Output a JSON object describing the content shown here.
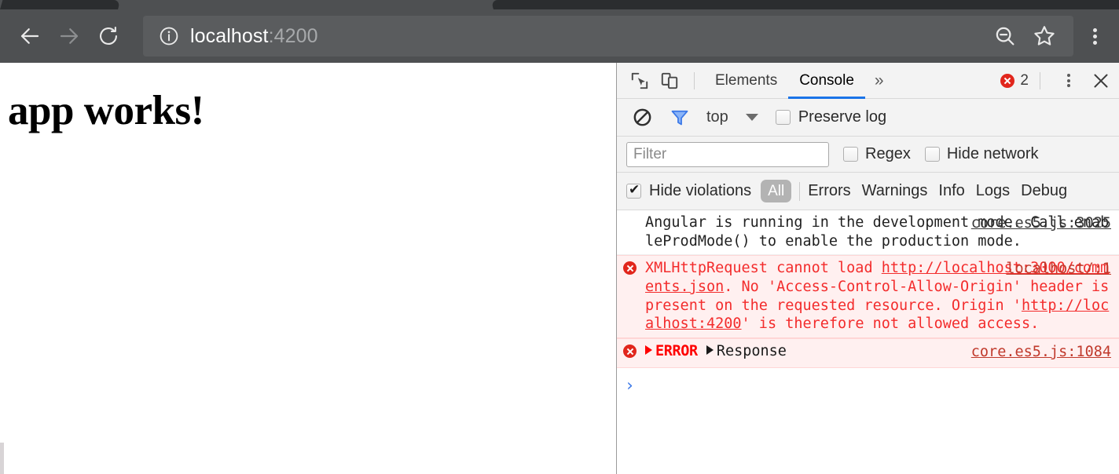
{
  "browser": {
    "back_icon": "arrow-left-icon",
    "forward_icon": "arrow-right-icon",
    "reload_icon": "reload-icon",
    "site_info_icon": "info-circle-icon",
    "url_host": "localhost",
    "url_port": ":4200",
    "zoom_out_icon": "magnifier-minus-icon",
    "bookmark_icon": "star-icon",
    "menu_icon": "kebab-menu-icon",
    "chrome_bg": "#4e5052",
    "omnibox_bg": "#5a5c5e"
  },
  "page": {
    "heading": "app works!"
  },
  "devtools": {
    "inspect_icon": "inspect-element-icon",
    "device_toolbar_icon": "device-toggle-icon",
    "tabs": [
      {
        "label": "Elements",
        "active": false
      },
      {
        "label": "Console",
        "active": true
      }
    ],
    "more_tabs_icon": "chevron-double-right-icon",
    "error_badge_icon": "error-circle-icon",
    "error_count": "2",
    "kebab_icon": "kebab-menu-icon",
    "close_icon": "close-x-icon",
    "accent": "#1a73e8"
  },
  "console_toolbar": {
    "clear_icon": "clear-console-icon",
    "filter_icon": "filter-funnel-icon",
    "context_label": "top",
    "context_caret_icon": "chevron-down-icon",
    "preserve_log_label": "Preserve log",
    "preserve_log_checked": false
  },
  "filter_bar": {
    "filter_placeholder": "Filter",
    "filter_value": "",
    "regex_label": "Regex",
    "regex_checked": false,
    "hide_network_label": "Hide network",
    "hide_network_checked": false
  },
  "levels_bar": {
    "hide_violations_label": "Hide violations",
    "hide_violations_checked": true,
    "selected_level": "All",
    "levels": [
      "Errors",
      "Warnings",
      "Info",
      "Logs",
      "Debug"
    ]
  },
  "console_messages": [
    {
      "type": "info",
      "icon": "",
      "text": "Angular is running in the development mode. Call enableProdMode() to enable the production mode.",
      "source": "core.es5.js:3025"
    },
    {
      "type": "error",
      "icon": "error-circle-icon",
      "text_part1": "XMLHttpRequest cannot load ",
      "link": "http://localhost:3000/comments.json",
      "text_part2": ". No 'Access-Control-Allow-Origin' header is present on the requested resource. Origin '",
      "link2": "http://localhost:4200",
      "text_part3": "' is therefore not allowed access.",
      "source": "localhost/:1"
    },
    {
      "type": "error-group",
      "icon": "error-circle-icon",
      "expand_icon": "disclosure-triangle-icon",
      "label": "ERROR",
      "value_expand_icon": "disclosure-triangle-icon",
      "value": "Response",
      "source": "core.es5.js:1084"
    }
  ],
  "console_prompt": {
    "caret": "›",
    "value": ""
  }
}
